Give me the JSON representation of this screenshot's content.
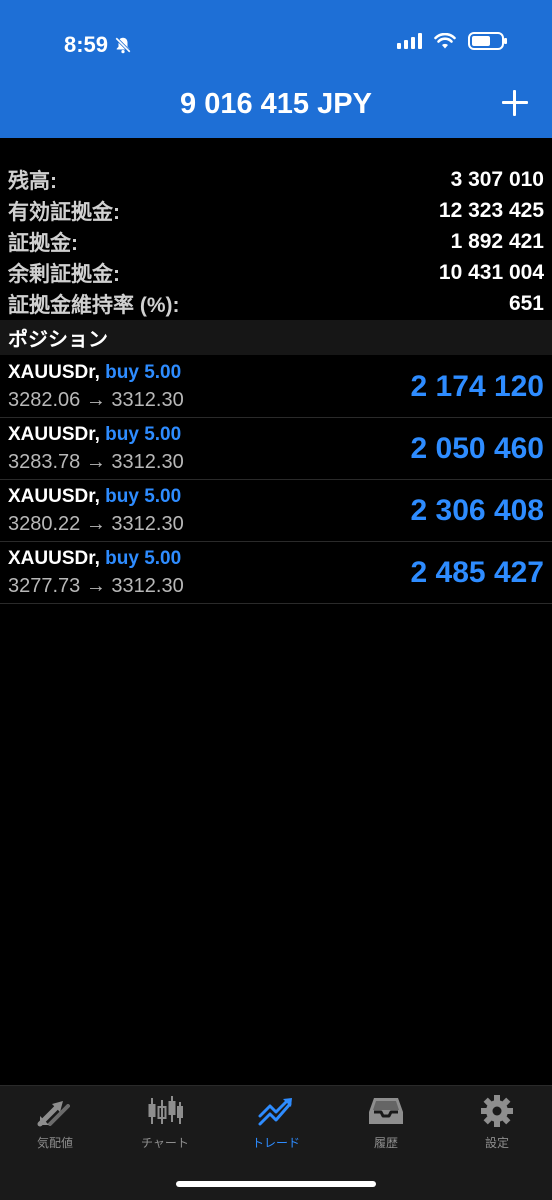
{
  "status_bar": {
    "time": "8:59"
  },
  "header": {
    "title": "9 016 415 JPY"
  },
  "summary": [
    {
      "label": "残高:",
      "value": "3 307 010"
    },
    {
      "label": "有効証拠金:",
      "value": "12 323 425"
    },
    {
      "label": "証拠金:",
      "value": "1 892 421"
    },
    {
      "label": "余剰証拠金:",
      "value": "10 431 004"
    },
    {
      "label": "証拠金維持率 (%):",
      "value": "651"
    }
  ],
  "positions_header": "ポジション",
  "positions": [
    {
      "symbol": "XAUUSDr,",
      "side": "buy 5.00",
      "prices": "3282.06 → 3312.30",
      "profit": "2 174 120"
    },
    {
      "symbol": "XAUUSDr,",
      "side": "buy 5.00",
      "prices": "3283.78 → 3312.30",
      "profit": "2 050 460"
    },
    {
      "symbol": "XAUUSDr,",
      "side": "buy 5.00",
      "prices": "3280.22 → 3312.30",
      "profit": "2 306 408"
    },
    {
      "symbol": "XAUUSDr,",
      "side": "buy 5.00",
      "prices": "3277.73 → 3312.30",
      "profit": "2 485 427"
    }
  ],
  "tabs": [
    {
      "label": "気配値",
      "icon": "quotes-arrows-icon"
    },
    {
      "label": "チャート",
      "icon": "candlestick-chart-icon"
    },
    {
      "label": "トレード",
      "icon": "trade-chart-icon",
      "active": true
    },
    {
      "label": "履歴",
      "icon": "inbox-tray-icon"
    },
    {
      "label": "設定",
      "icon": "gear-icon"
    }
  ],
  "colors": {
    "header_bg": "#1e6fd6",
    "accent": "#2e8cff",
    "background": "#000000"
  }
}
